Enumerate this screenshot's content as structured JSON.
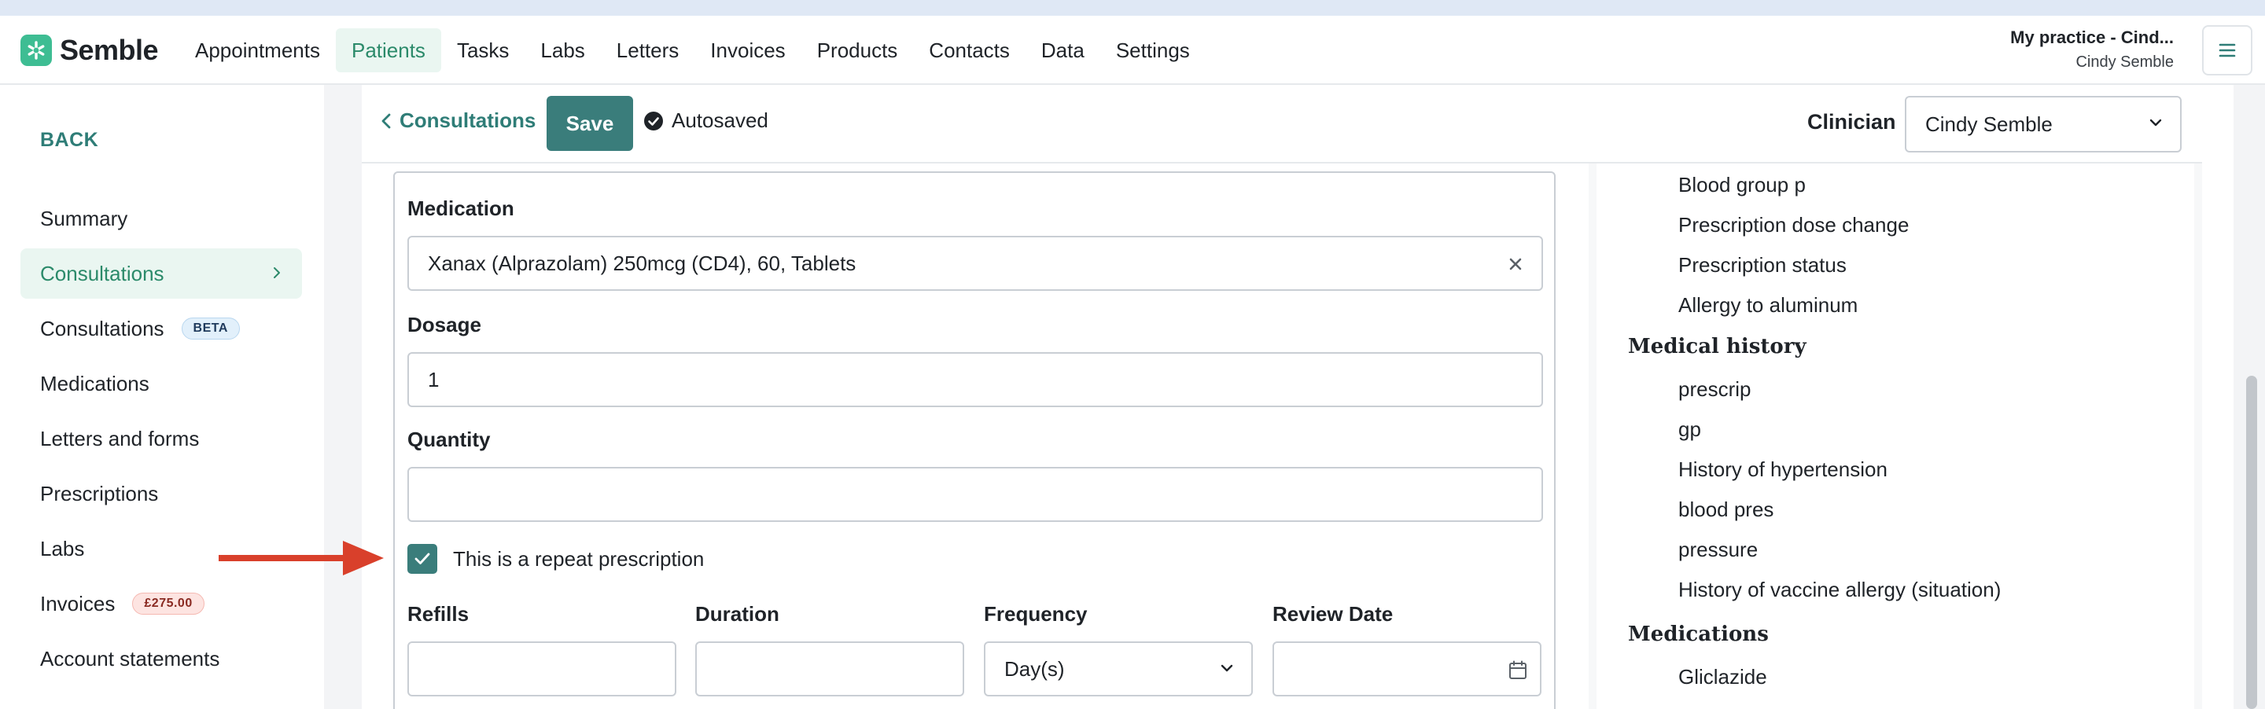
{
  "header": {
    "logo_text": "Semble",
    "nav": [
      "Appointments",
      "Patients",
      "Tasks",
      "Labs",
      "Letters",
      "Invoices",
      "Products",
      "Contacts",
      "Data",
      "Settings"
    ],
    "active_nav": "Patients",
    "practice_name": "My practice - Cind...",
    "practice_user": "Cindy Semble"
  },
  "sidebar": {
    "back_label": "BACK",
    "items": [
      {
        "label": "Summary"
      },
      {
        "label": "Consultations",
        "active": true
      },
      {
        "label": "Consultations",
        "badge": "BETA"
      },
      {
        "label": "Medications"
      },
      {
        "label": "Letters and forms"
      },
      {
        "label": "Prescriptions"
      },
      {
        "label": "Labs"
      },
      {
        "label": "Invoices",
        "badge": "£275.00"
      },
      {
        "label": "Account statements"
      }
    ]
  },
  "toolbar": {
    "back_label": "Consultations",
    "save_label": "Save",
    "autosaved_label": "Autosaved",
    "clinician_label": "Clinician",
    "clinician_value": "Cindy Semble"
  },
  "form": {
    "medication_label": "Medication",
    "medication_value": "Xanax (Alprazolam) 250mcg (CD4), 60, Tablets",
    "dosage_label": "Dosage",
    "dosage_value": "1",
    "quantity_label": "Quantity",
    "quantity_value": "",
    "repeat_label": "This is a repeat prescription",
    "repeat_checked": true,
    "refills_label": "Refills",
    "refills_value": "",
    "duration_label": "Duration",
    "duration_value": "",
    "frequency_label": "Frequency",
    "frequency_value": "Day(s)",
    "review_date_label": "Review Date",
    "review_date_value": ""
  },
  "right_panel": {
    "top_items": [
      "Blood group p",
      "Prescription dose change",
      "Prescription status",
      "Allergy to aluminum"
    ],
    "medical_history_title": "Medical history",
    "medical_history_items": [
      "prescrip",
      "gp",
      "History of hypertension",
      "blood pres",
      "pressure",
      "History of vaccine allergy (situation)"
    ],
    "medications_title": "Medications",
    "medications_items": [
      "Gliclazide"
    ]
  },
  "colors": {
    "brand": "#3ebd93",
    "primary": "#3a7d7b",
    "link": "#2f7d77",
    "active_bg": "#eaf6f1",
    "annotation_arrow": "#d9402b"
  }
}
